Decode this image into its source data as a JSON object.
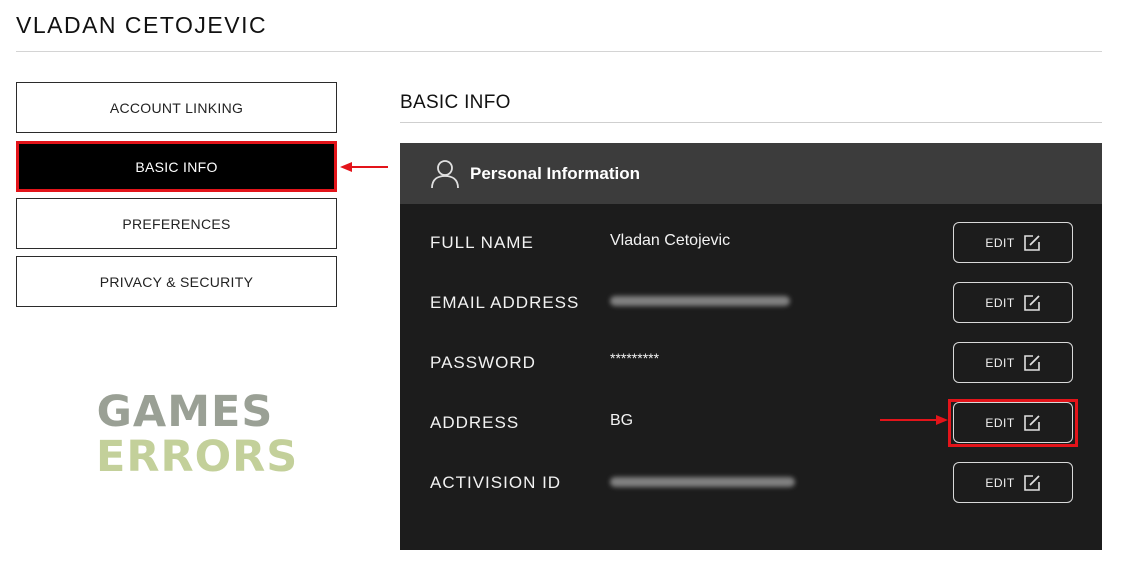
{
  "user": {
    "name": "VLADAN CETOJEVIC"
  },
  "sidebar": {
    "items": [
      {
        "label": "ACCOUNT LINKING",
        "active": false
      },
      {
        "label": "BASIC INFO",
        "active": true
      },
      {
        "label": "PREFERENCES",
        "active": false
      },
      {
        "label": "PRIVACY & SECURITY",
        "active": false
      }
    ]
  },
  "watermark": {
    "line1": "GAMES",
    "line2": "ERRORS"
  },
  "main": {
    "heading": "BASIC INFO",
    "card": {
      "title": "Personal Information",
      "icon": "person-icon",
      "rows": [
        {
          "label": "FULL NAME",
          "value": "Vladan Cetojevic",
          "edit_label": "EDIT"
        },
        {
          "label": "EMAIL ADDRESS",
          "value": "",
          "edit_label": "EDIT"
        },
        {
          "label": "PASSWORD",
          "value": "*********",
          "edit_label": "EDIT"
        },
        {
          "label": "ADDRESS",
          "value": "BG",
          "edit_label": "EDIT"
        },
        {
          "label": "ACTIVISION ID",
          "value": "",
          "edit_label": "EDIT"
        }
      ]
    }
  },
  "colors": {
    "highlight": "#e3141a",
    "card_bg": "#1c1c1c",
    "card_header_bg": "#3c3c3c",
    "active_nav_bg": "#000000"
  }
}
